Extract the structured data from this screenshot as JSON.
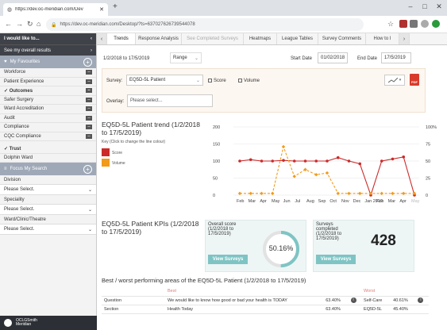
{
  "browser": {
    "tab_title": "https://dev.oc-meridian.com/Dev",
    "url": "https://dev.oc-meridian.com/Desktop/?ts=637027626739544078"
  },
  "sidebar": {
    "header": "I would like to...",
    "see_results": "See my overall results",
    "favourites_label": "My Favourites",
    "items": [
      {
        "label": "Workforce",
        "active": false
      },
      {
        "label": "Patient Experience",
        "active": false
      },
      {
        "label": "✓ Outcomes",
        "active": true
      },
      {
        "label": "Safer Surgery",
        "active": false
      },
      {
        "label": "Ward Accreditation",
        "active": false
      },
      {
        "label": "Audit",
        "active": false
      },
      {
        "label": "Compliance",
        "active": false
      },
      {
        "label": "CQC Compliance",
        "active": false
      }
    ],
    "trust_label": "✓ Trust",
    "ward_label": "Dolphin Ward",
    "focus_label": "Focus My Search",
    "division_label": "Division",
    "division_value": "Please Select.",
    "speciality_label": "Speciality",
    "speciality_value": "Please Select.",
    "ward_clinic_label": "Ward/Clinic/Theatre",
    "ward_clinic_value": "Please Select.",
    "logo_text_1": "OCLGSmith",
    "logo_text_2": "Meridian"
  },
  "tabs": [
    {
      "label": "Trends",
      "active": true,
      "dim": false
    },
    {
      "label": "Response Analysis",
      "active": false,
      "dim": false
    },
    {
      "label": "See Completed Surveys",
      "active": false,
      "dim": true
    },
    {
      "label": "Heatmaps",
      "active": false,
      "dim": false
    },
    {
      "label": "League Tables",
      "active": false,
      "dim": false
    },
    {
      "label": "Survey Comments",
      "active": false,
      "dim": false
    },
    {
      "label": "How to I",
      "active": false,
      "dim": false
    }
  ],
  "filters": {
    "date_range_text": "1/2/2018 to 17/5/2019",
    "range_label": "Range",
    "start_date_label": "Start Date",
    "start_date": "01/02/2018",
    "end_date_label": "End Date",
    "end_date": "17/5/2019",
    "survey_label": "Survey:",
    "survey_value": "EQ5D-5L Patient",
    "score_label": "Score",
    "volume_label": "Volume",
    "overlay_label": "Overlay:",
    "overlay_placeholder": "Please select..."
  },
  "chart_data": {
    "type": "line",
    "title": "EQ5D-5L Patient trend (1/2/2018 to 17/5/2019)",
    "key_caption": "Key (Click to change the line colour)",
    "categories": [
      "Feb",
      "Mar",
      "Apr",
      "May",
      "Jun",
      "Jul",
      "Aug",
      "Sep",
      "Oct",
      "Nov",
      "Dec",
      "Jan 2019",
      "Feb",
      "Mar",
      "Apr",
      "May"
    ],
    "series": [
      {
        "name": "Score",
        "color": "#cc2a2a",
        "axis": "right",
        "values": [
          50,
          52,
          50,
          50,
          51,
          50,
          50,
          50,
          50,
          55,
          50,
          46,
          0,
          50,
          53,
          56,
          0
        ]
      },
      {
        "name": "Volume",
        "color": "#f29a1a",
        "axis": "left",
        "values": [
          5,
          5,
          5,
          5,
          142,
          55,
          75,
          60,
          65,
          5,
          5,
          5,
          5,
          5,
          5,
          5,
          5
        ]
      }
    ],
    "left_axis": {
      "min": 0,
      "max": 200,
      "ticks": [
        "0",
        "50",
        "100",
        "150",
        "200"
      ]
    },
    "right_axis": {
      "min": 0,
      "max": 100,
      "ticks": [
        "0",
        "25",
        "50",
        "75",
        "100%"
      ]
    },
    "grid": true,
    "legend": "left"
  },
  "kpi": {
    "title": "EQ5D-5L Patient KPIs (1/2/2018 to 17/5/2019)",
    "overall_label": "Overall score (1/2/2018 to 17/5/2019)",
    "overall_value": "50.16%",
    "overall_fraction": 0.5016,
    "completed_label": "Surveys completed (1/2/2018 to 17/5/2019)",
    "completed_value": "428",
    "view_surveys": "View Surveys"
  },
  "bestworst": {
    "title": "Best / worst performing areas of the EQ5D-5L Patient (1/2/2018 to 17/5/2019)",
    "best_header": "Best",
    "worst_header": "Worst",
    "rows": [
      {
        "label": "Question",
        "best": "We would like to know how good or bad your health is TODAY",
        "best_pct": "63.40%",
        "worst": "Self-Care",
        "worst_pct": "40.61%"
      },
      {
        "label": "Section",
        "best": "Health Today",
        "best_pct": "63.40%",
        "worst": "EQ5D-5L",
        "worst_pct": "45.40%"
      }
    ]
  },
  "colors": {
    "sidebar_dark": "#3f4249",
    "accent_teal": "#7fc4c4",
    "score_red": "#cc2a2a",
    "volume_orange": "#f29a1a"
  }
}
